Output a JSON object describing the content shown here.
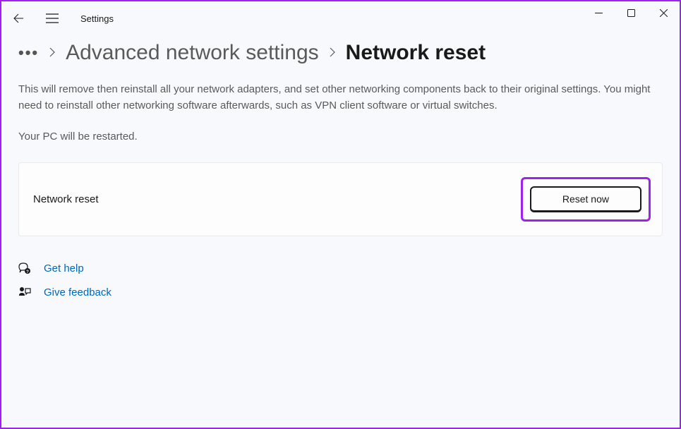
{
  "window": {
    "app_title": "Settings"
  },
  "breadcrumb": {
    "parent": "Advanced network settings",
    "current": "Network reset"
  },
  "page": {
    "description": "This will remove then reinstall all your network adapters, and set other networking components back to their original settings. You might need to reinstall other networking software afterwards, such as VPN client software or virtual switches.",
    "restart_note": "Your PC will be restarted."
  },
  "card": {
    "label": "Network reset",
    "button_label": "Reset now"
  },
  "links": {
    "help": "Get help",
    "feedback": "Give feedback"
  }
}
